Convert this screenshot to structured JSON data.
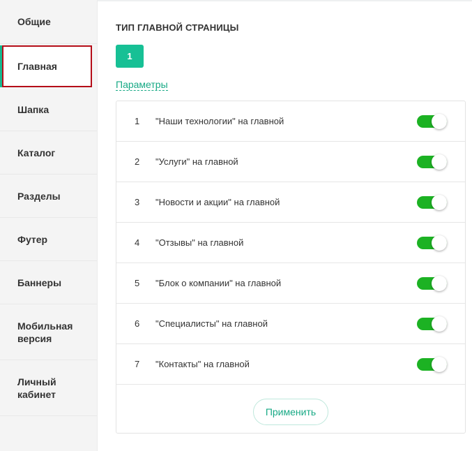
{
  "sidebar": {
    "items": [
      {
        "label": "Общие"
      },
      {
        "label": "Главная"
      },
      {
        "label": "Шапка"
      },
      {
        "label": "Каталог"
      },
      {
        "label": "Разделы"
      },
      {
        "label": "Футер"
      },
      {
        "label": "Баннеры"
      },
      {
        "label": "Мобильная версия"
      },
      {
        "label": "Личный кабинет"
      }
    ],
    "active": "Главная"
  },
  "main": {
    "section_title": "ТИП ГЛАВНОЙ СТРАНИЦЫ",
    "type_button": "1",
    "params_link": "Параметры",
    "rows": [
      {
        "num": "1",
        "label": "\"Наши технологии\" на главной",
        "enabled": true
      },
      {
        "num": "2",
        "label": "\"Услуги\" на главной",
        "enabled": true
      },
      {
        "num": "3",
        "label": "\"Новости и акции\" на главной",
        "enabled": true
      },
      {
        "num": "4",
        "label": "\"Отзывы\" на главной",
        "enabled": true
      },
      {
        "num": "5",
        "label": "\"Блок о компании\" на главной",
        "enabled": true
      },
      {
        "num": "6",
        "label": "\"Специалисты\" на главной",
        "enabled": true
      },
      {
        "num": "7",
        "label": "\"Контакты\" на главной",
        "enabled": true
      }
    ],
    "apply_label": "Применить"
  },
  "colors": {
    "accent": "#17c095",
    "toggle_on": "#1cb223",
    "highlight_border": "#b50d18"
  }
}
